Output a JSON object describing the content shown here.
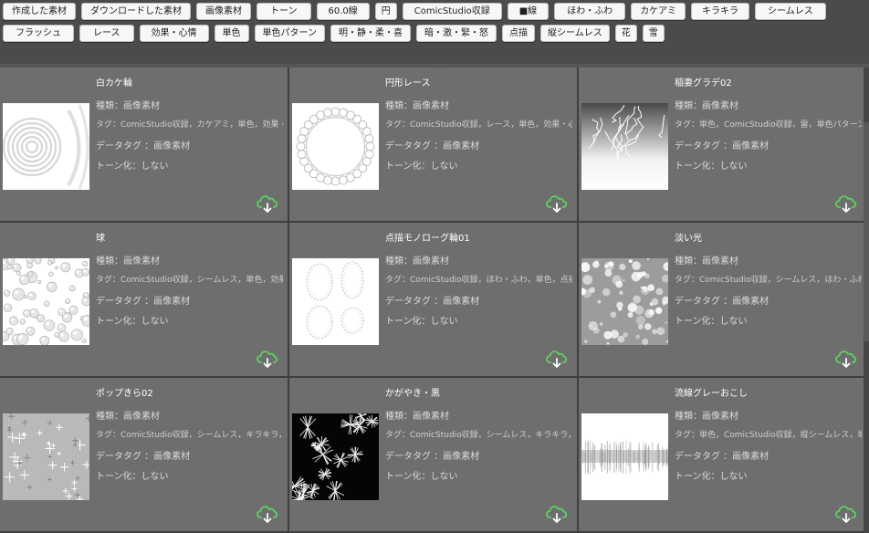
{
  "tags_row1": [
    "作成した素材",
    "ダウンロードした素材",
    "画像素材",
    "トーン",
    "60.0線",
    "円",
    "ComicStudio収録",
    "■線",
    "ほわ・ふわ",
    "カケアミ",
    "キラキラ",
    "シームレス"
  ],
  "tags_row2": [
    "フラッシュ",
    "レース",
    "効果・心情",
    "単色",
    "単色パターン",
    "明・静・柔・喜",
    "暗・激・緊・怒",
    "点描",
    "縦シームレス",
    "花",
    "雪"
  ],
  "colors": {
    "download_icon": "#5bd45b",
    "card_bg": "#6e6e6e",
    "tag_bg": "#f7f7f7"
  },
  "items": [
    {
      "title": "白カケ輪",
      "kind": "種類：画像素材",
      "tags": "タグ：ComicStudio収録，カケアミ，単色，効果・心情，単色",
      "data_tag": "データタグ ：画像素材",
      "tone": "トーン化：しない",
      "preview": "rings"
    },
    {
      "title": "円形レース",
      "kind": "種類：画像素材",
      "tags": "タグ：ComicStudio収録，レース，単色，効果・心情，単色",
      "data_tag": "データタグ ：画像素材",
      "tone": "トーン化：しない",
      "preview": "lace"
    },
    {
      "title": "稲妻グラデ02",
      "kind": "種類：画像素材",
      "tags": "タグ：単色，ComicStudio収録，雷，単色パターン，単色",
      "data_tag": "データタグ ：画像素材",
      "tone": "トーン化：しない",
      "preview": "lightning"
    },
    {
      "title": "球",
      "kind": "種類：画像素材",
      "tags": "タグ：ComicStudio収録，シームレス，単色，効果・心情，単色",
      "data_tag": "データタグ ：画像素材",
      "tone": "トーン化：しない",
      "preview": "spheres"
    },
    {
      "title": "点描モノローグ輪01",
      "kind": "種類：画像素材",
      "tags": "タグ：ComicStudio収録，ほわ・ふわ，単色，点描，効果・心",
      "data_tag": "データタグ ：画像素材",
      "tone": "トーン化：しない",
      "preview": "monologue"
    },
    {
      "title": "淡い光",
      "kind": "種類：画像素材",
      "tags": "タグ：ComicStudio収録，シームレス，ほわ・ふわ，単色，効果",
      "data_tag": "データタグ ：画像素材",
      "tone": "トーン化：しない",
      "preview": "bokeh"
    },
    {
      "title": "ポップきら02",
      "kind": "種類：画像素材",
      "tags": "タグ：ComicStudio収録，シームレス，キラキラ，単色，効果",
      "data_tag": "データタグ ：画像素材",
      "tone": "トーン化：しない",
      "preview": "sparkle"
    },
    {
      "title": "かがやき・黒",
      "kind": "種類：画像素材",
      "tags": "タグ：ComicStudio収録，シームレス，キラキラ，単色，効果",
      "data_tag": "データタグ ：画像素材",
      "tone": "トーン化：しない",
      "preview": "black"
    },
    {
      "title": "流線グレーおこし",
      "kind": "種類：画像素材",
      "tags": "タグ：単色，ComicStudio収録，縦シームレス，単色パターン",
      "data_tag": "データタグ ：画像素材",
      "tone": "トーン化：しない",
      "preview": "streak"
    }
  ]
}
